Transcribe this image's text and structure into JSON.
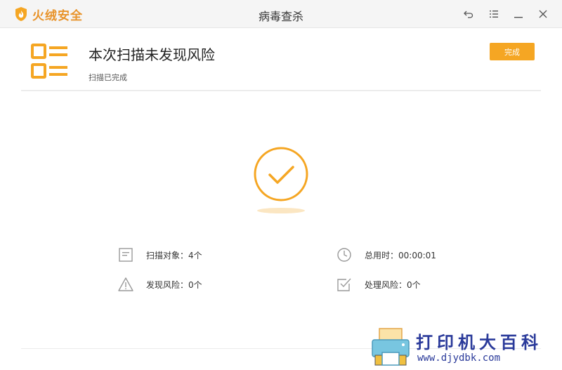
{
  "app": {
    "brand_name": "火绒安全",
    "window_title": "病毒查杀"
  },
  "window_controls": {
    "back": "back-arrow-icon",
    "menu": "menu-list-icon",
    "minimize": "minimize-icon",
    "close": "close-icon"
  },
  "header": {
    "headline": "本次扫描未发现风险",
    "status": "扫描已完成",
    "done_label": "完成"
  },
  "stats": {
    "scan_objects": "扫描对象：4个",
    "time_used": "总用时：00:00:01",
    "risks_found": "发现风险：0个",
    "risks_handled": "处理风险：0个"
  },
  "watermark": {
    "title": "打印机大百科",
    "url": "www.djydbk.com"
  },
  "colors": {
    "accent": "#f5a623",
    "icon_gray": "#999999",
    "watermark_blue": "#2a3a9a"
  }
}
